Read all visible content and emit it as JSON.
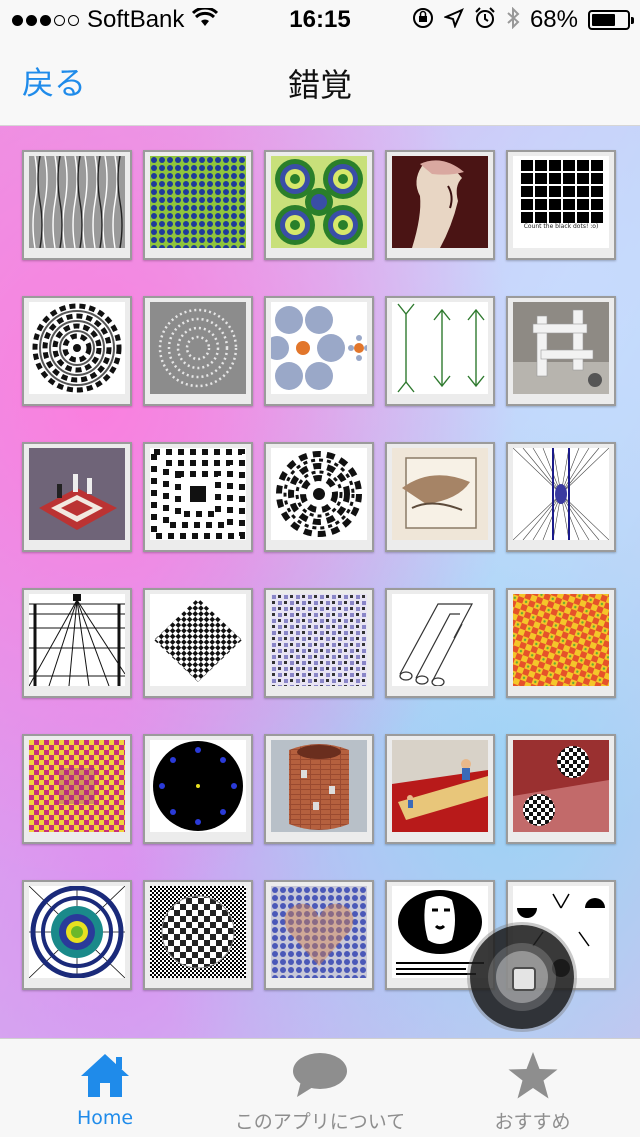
{
  "status_bar": {
    "carrier": "SoftBank",
    "signal_bars_filled": 3,
    "signal_bars_total": 5,
    "time": "16:15",
    "battery_percent": "68%",
    "battery_level": 0.68
  },
  "nav": {
    "back_label": "戻る",
    "title": "錯覚"
  },
  "thumbnails": [
    {
      "name": "thumb-gray-wavy-lines",
      "icon": "gray-stripes"
    },
    {
      "name": "thumb-green-blue-dots",
      "icon": "green-blue-dots"
    },
    {
      "name": "thumb-rotating-snakes",
      "icon": "rotating-snakes"
    },
    {
      "name": "thumb-old-young-woman",
      "icon": "old-woman-portrait"
    },
    {
      "name": "thumb-black-grid",
      "icon": "hermann-grid",
      "caption": "Count the black dots! :o)"
    },
    {
      "name": "thumb-spiral-swirl",
      "icon": "spiral"
    },
    {
      "name": "thumb-gray-dot-circles",
      "icon": "gray-dot-circles"
    },
    {
      "name": "thumb-ebbinghaus-circles",
      "icon": "ebbinghaus"
    },
    {
      "name": "thumb-muller-lyer-arrows",
      "icon": "muller-lyer"
    },
    {
      "name": "thumb-impossible-structure",
      "icon": "impossible-structure"
    },
    {
      "name": "thumb-chess-board",
      "icon": "chess-board"
    },
    {
      "name": "thumb-checker-tunnel",
      "icon": "checker-tunnel"
    },
    {
      "name": "thumb-checker-vortex",
      "icon": "checker-vortex"
    },
    {
      "name": "thumb-escher-drawing",
      "icon": "escher-drawing"
    },
    {
      "name": "thumb-hering-lines",
      "icon": "hering-lines"
    },
    {
      "name": "thumb-perspective-grid",
      "icon": "perspective-grid"
    },
    {
      "name": "thumb-checker-diamond",
      "icon": "checker-diamond"
    },
    {
      "name": "thumb-pattern-grid",
      "icon": "pattern-grid"
    },
    {
      "name": "thumb-impossible-fork",
      "icon": "impossible-fork"
    },
    {
      "name": "thumb-red-yellow-pattern",
      "icon": "red-yellow-pattern"
    },
    {
      "name": "thumb-pink-yellow-checker",
      "icon": "pink-yellow-checker"
    },
    {
      "name": "thumb-blue-dots-circle",
      "icon": "blue-dots-circle"
    },
    {
      "name": "thumb-brick-tower",
      "icon": "brick-tower"
    },
    {
      "name": "thumb-size-illusion-room",
      "icon": "size-illusion-room"
    },
    {
      "name": "thumb-checkered-spheres",
      "icon": "checkered-spheres"
    },
    {
      "name": "thumb-concentric-rings",
      "icon": "concentric-rings"
    },
    {
      "name": "thumb-checker-sphere",
      "icon": "checker-sphere"
    },
    {
      "name": "thumb-dots-heart",
      "icon": "dots-heart"
    },
    {
      "name": "thumb-jesus-face",
      "icon": "jesus-face"
    },
    {
      "name": "thumb-kanizsa-triangle",
      "icon": "kanizsa-triangle"
    }
  ],
  "tabs": [
    {
      "label": "Home",
      "icon": "house-icon",
      "active": true
    },
    {
      "label": "このアプリについて",
      "icon": "speech-bubble-icon",
      "active": false
    },
    {
      "label": "おすすめ",
      "icon": "star-icon",
      "active": false
    }
  ],
  "colors": {
    "accent": "#1f8bea",
    "inactive": "#8e8e8e"
  }
}
